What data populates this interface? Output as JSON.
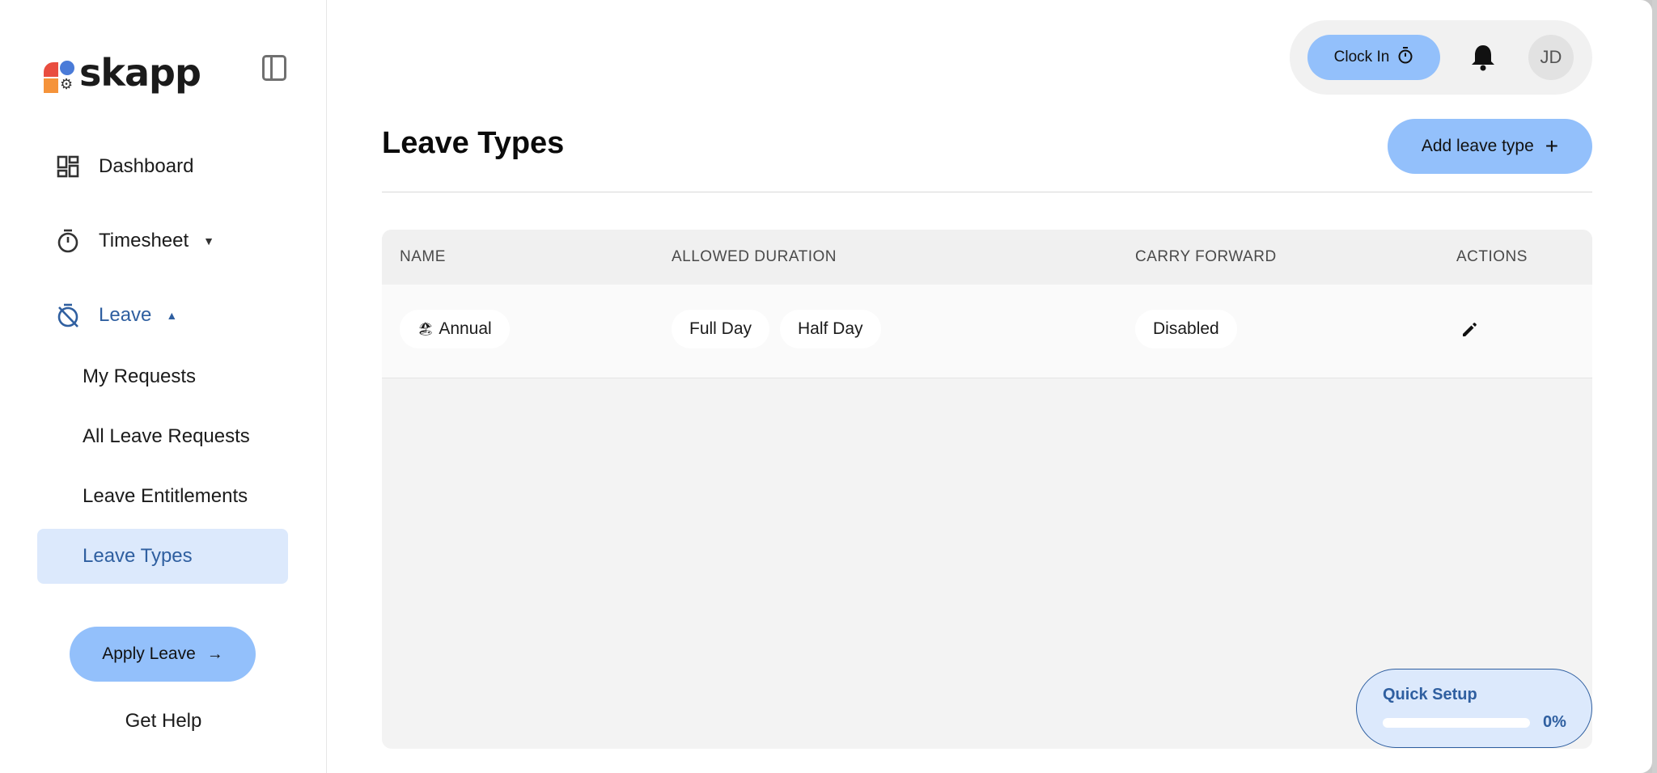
{
  "brand": {
    "name": "skapp"
  },
  "sidebar": {
    "nav": [
      {
        "label": "Dashboard",
        "icon": "dashboard-icon"
      },
      {
        "label": "Timesheet",
        "icon": "stopwatch-icon"
      },
      {
        "label": "Leave",
        "icon": "leave-icon"
      }
    ],
    "leave_sub": [
      "My Requests",
      "All Leave Requests",
      "Leave Entitlements",
      "Leave Types"
    ],
    "apply_label": "Apply Leave",
    "help_label": "Get Help"
  },
  "topbar": {
    "clock_label": "Clock In",
    "avatar_initials": "JD"
  },
  "page": {
    "title": "Leave Types",
    "add_label": "Add leave type"
  },
  "table": {
    "headers": [
      "NAME",
      "ALLOWED DURATION",
      "CARRY FORWARD",
      "ACTIONS"
    ],
    "rows": [
      {
        "name": "Annual",
        "emoji": "🏖",
        "durations": [
          "Full Day",
          "Half Day"
        ],
        "carry_forward": "Disabled"
      }
    ]
  },
  "quick_setup": {
    "label": "Quick Setup",
    "percent_text": "0%",
    "progress": 0
  },
  "colors": {
    "accent": "#93c0fb",
    "primary": "#2f5fa0",
    "selected_bg": "#dce9fc"
  }
}
